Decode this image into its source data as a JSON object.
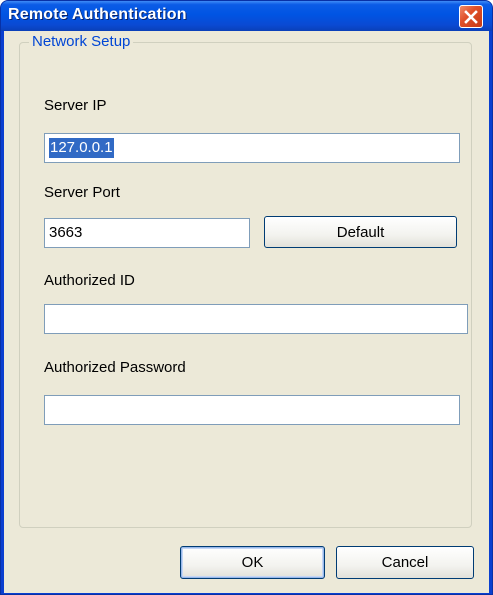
{
  "window": {
    "title": "Remote Authentication",
    "close_icon": "close-icon"
  },
  "network_setup": {
    "legend": "Network Setup",
    "server_ip_label": "Server IP",
    "server_ip_value": "127.0.0.1",
    "server_port_label": "Server Port",
    "server_port_value": "3663",
    "default_button": "Default",
    "authorized_id_label": "Authorized ID",
    "authorized_id_value": "",
    "authorized_password_label": "Authorized Password",
    "authorized_password_value": ""
  },
  "footer": {
    "ok_button": "OK",
    "cancel_button": "Cancel"
  },
  "colors": {
    "titlebar": "#0054e3",
    "dialog_bg": "#ece9d8",
    "legend_text": "#0046d5",
    "close_button": "#e0502a",
    "selection": "#316ac5"
  }
}
